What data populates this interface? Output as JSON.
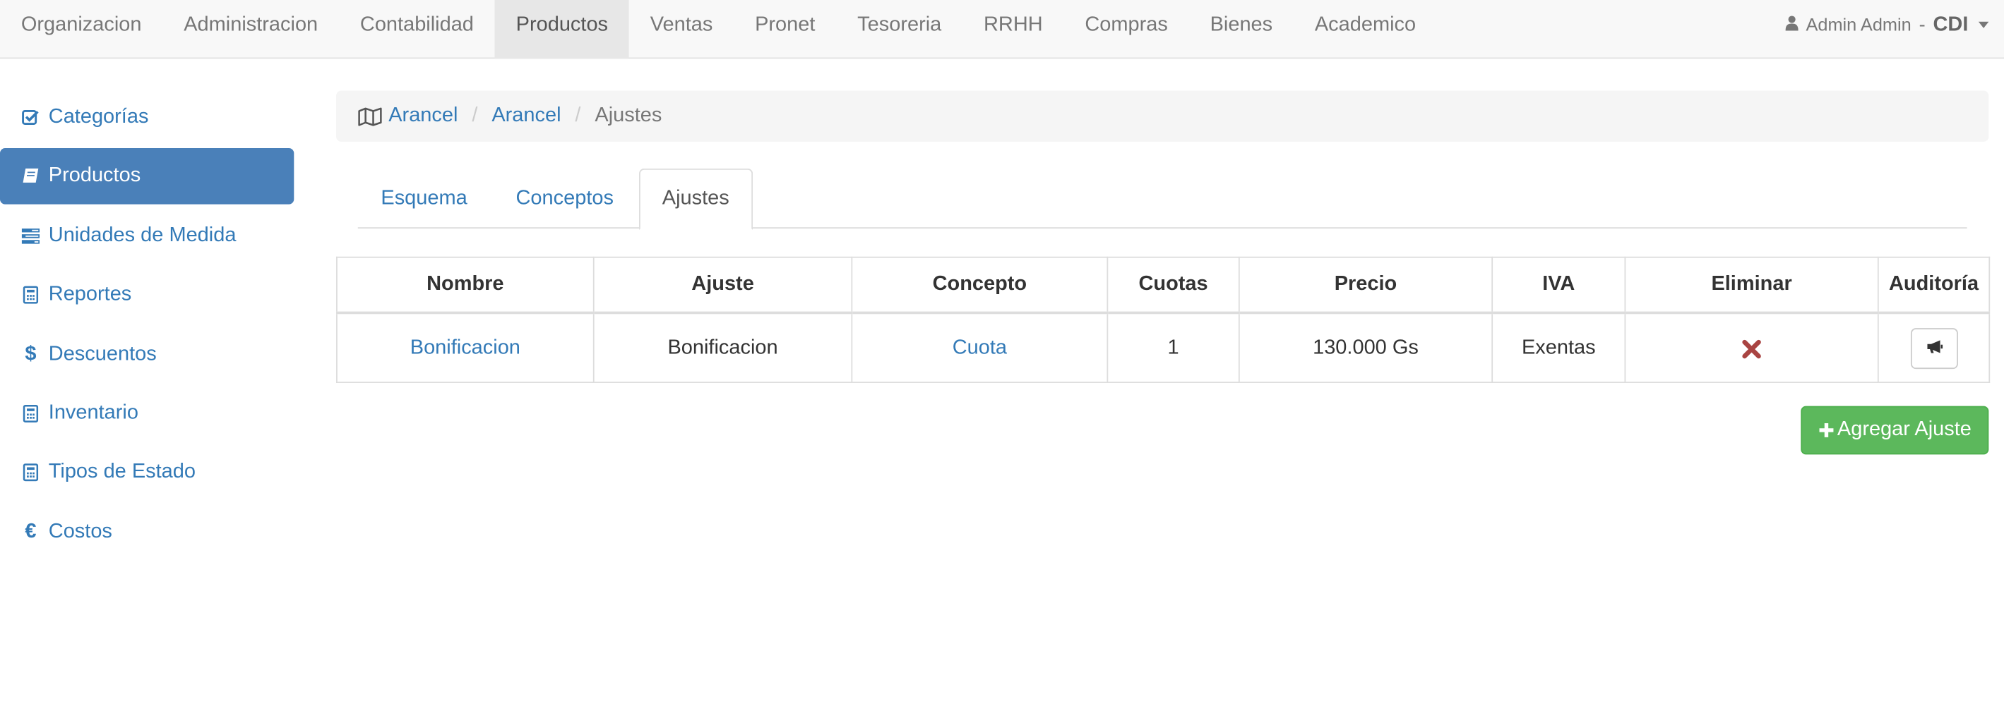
{
  "navbar": {
    "menu": [
      {
        "label": "Organizacion",
        "active": false
      },
      {
        "label": "Administracion",
        "active": false
      },
      {
        "label": "Contabilidad",
        "active": false
      },
      {
        "label": "Productos",
        "active": true
      },
      {
        "label": "Ventas",
        "active": false
      },
      {
        "label": "Pronet",
        "active": false
      },
      {
        "label": "Tesoreria",
        "active": false
      },
      {
        "label": "RRHH",
        "active": false
      },
      {
        "label": "Compras",
        "active": false
      },
      {
        "label": "Bienes",
        "active": false
      },
      {
        "label": "Academico",
        "active": false
      }
    ],
    "user": {
      "name": "Admin Admin",
      "separator": "-",
      "org": "CDI",
      "icon": "user-icon"
    }
  },
  "sidebar": {
    "items": [
      {
        "label": "Categorías",
        "icon": "check-square-icon",
        "active": false
      },
      {
        "label": "Productos",
        "icon": "book-icon",
        "active": true
      },
      {
        "label": "Unidades de Medida",
        "icon": "tasks-icon",
        "active": false
      },
      {
        "label": "Reportes",
        "icon": "calculator-icon",
        "active": false
      },
      {
        "label": "Descuentos",
        "icon": "dollar-icon",
        "active": false
      },
      {
        "label": "Inventario",
        "icon": "calculator-icon",
        "active": false
      },
      {
        "label": "Tipos de Estado",
        "icon": "calculator-icon",
        "active": false
      },
      {
        "label": "Costos",
        "icon": "euro-icon",
        "active": false
      }
    ]
  },
  "breadcrumb": {
    "icon": "map-icon",
    "items": [
      "Arancel",
      "Arancel"
    ],
    "current": "Ajustes"
  },
  "tabs": [
    {
      "label": "Esquema",
      "active": false
    },
    {
      "label": "Conceptos",
      "active": false
    },
    {
      "label": "Ajustes",
      "active": true
    }
  ],
  "table": {
    "headers": [
      "Nombre",
      "Ajuste",
      "Concepto",
      "Cuotas",
      "Precio",
      "IVA",
      "Eliminar",
      "Auditoría"
    ],
    "rows": [
      {
        "nombre": "Bonificacion",
        "ajuste": "Bonificacion",
        "concepto": "Cuota",
        "cuotas": "1",
        "precio": "130.000 Gs",
        "iva": "Exentas",
        "eliminar_icon": "remove-icon",
        "auditoria_icon": "bullhorn-icon"
      }
    ]
  },
  "actions": {
    "add_label": "Agregar Ajuste",
    "add_icon": "plus-icon"
  },
  "colors": {
    "link": "#337ab7",
    "sidebar_active": "#4a80b9",
    "success": "#5cb85c",
    "danger": "#a94442"
  }
}
